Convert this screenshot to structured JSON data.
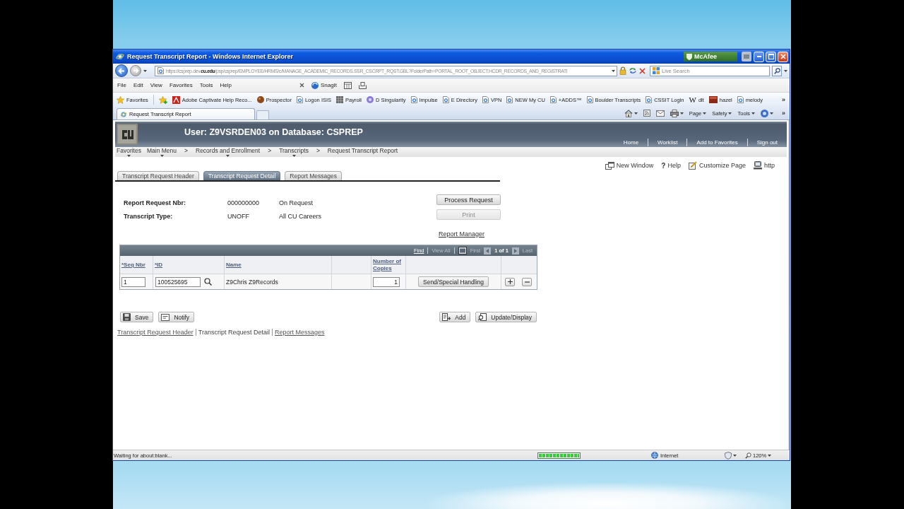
{
  "window": {
    "title": "Request Transcript Report - Windows Internet Explorer",
    "security_badge": "McAfee"
  },
  "address_bar": {
    "url": "https://csprep.dev.**cu.edu**/psp/csprep/EMPLOYEE/HRMS/c/MANAGE_ACADEMIC_RECORDS.SSR_CSCRPT_RQST.GBL?FolderPath=PORTAL_ROOT_OBJECT.HCDR_RECORDS_AND_REGISTRATI",
    "search_placeholder": "Live Search"
  },
  "menu_bar": {
    "items": [
      "File",
      "Edit",
      "View",
      "Favorites",
      "Tools",
      "Help"
    ],
    "capture_tool": "SnagIt"
  },
  "favorites_bar": {
    "label": "Favorites",
    "items": [
      {
        "label": "Adobe Captivate Help Reco...",
        "kind": "tile"
      },
      {
        "label": "Prospector",
        "kind": "ball"
      },
      {
        "label": "Logon ISIS",
        "kind": "page"
      },
      {
        "label": "Payroll",
        "kind": "grid"
      },
      {
        "label": "D Singularity",
        "kind": "disc"
      },
      {
        "label": "Impulse",
        "kind": "page"
      },
      {
        "label": "E Directory",
        "kind": "page"
      },
      {
        "label": "VPN",
        "kind": "page"
      },
      {
        "label": "NEW My CU",
        "kind": "page"
      },
      {
        "label": "+ADDS™",
        "kind": "page"
      },
      {
        "label": "Boulder Transcripts",
        "kind": "page"
      },
      {
        "label": "CSSIT Login",
        "kind": "page"
      },
      {
        "label": "dlt",
        "kind": "glyph",
        "glyph": "W"
      },
      {
        "label": "hazel",
        "kind": "book"
      },
      {
        "label": "melody",
        "kind": "page"
      }
    ],
    "overflow": "»"
  },
  "tab_bar": {
    "tabs": [
      {
        "label": "Request Transcript Report",
        "selected": true
      }
    ],
    "commands": [
      {
        "kind": "home",
        "menu": true
      },
      {
        "kind": "feeds",
        "menu": false
      },
      {
        "kind": "mail",
        "menu": false
      },
      {
        "kind": "print",
        "menu": true
      },
      {
        "kind": "text",
        "label": "Page",
        "menu": true
      },
      {
        "kind": "text",
        "label": "Safety",
        "menu": true
      },
      {
        "kind": "text",
        "label": "Tools",
        "menu": true
      },
      {
        "kind": "help",
        "menu": true
      }
    ],
    "overflow": "»"
  },
  "page": {
    "banner": "User: Z9VSRDEN03 on Database: CSPREP",
    "header_links": [
      "Home",
      "Worklist",
      "Add to Favorites",
      "Sign out"
    ],
    "breadcrumbs": [
      {
        "label": "Favorites",
        "menu": true
      },
      {
        "label": "Main Menu",
        "menu": true,
        "separator": ">"
      },
      {
        "label": "Records and Enrollment",
        "menu": true,
        "separator": ">"
      },
      {
        "label": "Transcripts",
        "menu": true,
        "separator": ">"
      },
      {
        "label": "Request Transcript Report",
        "menu": false
      }
    ],
    "toolbar": [
      {
        "kind": "new-window",
        "label": "New Window"
      },
      {
        "kind": "glyph",
        "glyph": "?",
        "label": "Help"
      },
      {
        "kind": "customize",
        "label": "Customize Page"
      },
      {
        "kind": "http",
        "label": "http"
      }
    ],
    "tabs": [
      {
        "label": "Transcript Request Header",
        "selected": false
      },
      {
        "label": "Transcript Request Detail",
        "selected": true
      },
      {
        "label": "Report Messages",
        "selected": false
      }
    ],
    "fields": [
      {
        "label": "Report Request Nbr:",
        "value": "000000000",
        "description": "On Request"
      },
      {
        "label": "Transcript Type:",
        "value": "UNOFF",
        "description": "All CU Careers"
      }
    ],
    "actions": [
      {
        "label": "Process Request",
        "disabled": false
      },
      {
        "label": "Print",
        "disabled": true
      }
    ],
    "report_manager": "Report Manager",
    "grid": {
      "nav": {
        "find": {
          "label": "Find",
          "disabled": false
        },
        "view_all": {
          "label": "View All",
          "disabled": true
        },
        "first": {
          "label": "First",
          "disabled": true
        },
        "count": "1 of 1",
        "last": {
          "label": "Last",
          "disabled": true
        }
      },
      "columns": [
        "*Seq Nbr",
        "*ID",
        "Name",
        "Number of Copies"
      ],
      "rows": [
        {
          "seq_nbr": "1",
          "id": "100525695",
          "name": "Z9Chris Z9Records",
          "copies": "1",
          "action": "Send/Special Handling"
        }
      ]
    },
    "buttons": {
      "left": [
        {
          "kind": "save",
          "label": "Save"
        },
        {
          "kind": "notify",
          "label": "Notify"
        }
      ],
      "right": [
        {
          "kind": "add",
          "label": "Add"
        },
        {
          "kind": "update",
          "label": "Update/Display"
        }
      ]
    },
    "footer_links": [
      {
        "label": "Transcript Request Header",
        "selected": false
      },
      {
        "label": "Transcript Request Detail",
        "selected": true
      },
      {
        "label": "Report Messages",
        "selected": false
      }
    ]
  },
  "status_bar": {
    "message": "Waiting for about:blank...",
    "progress": {
      "level": 1
    },
    "zone": "Internet",
    "zoom": "120%"
  }
}
